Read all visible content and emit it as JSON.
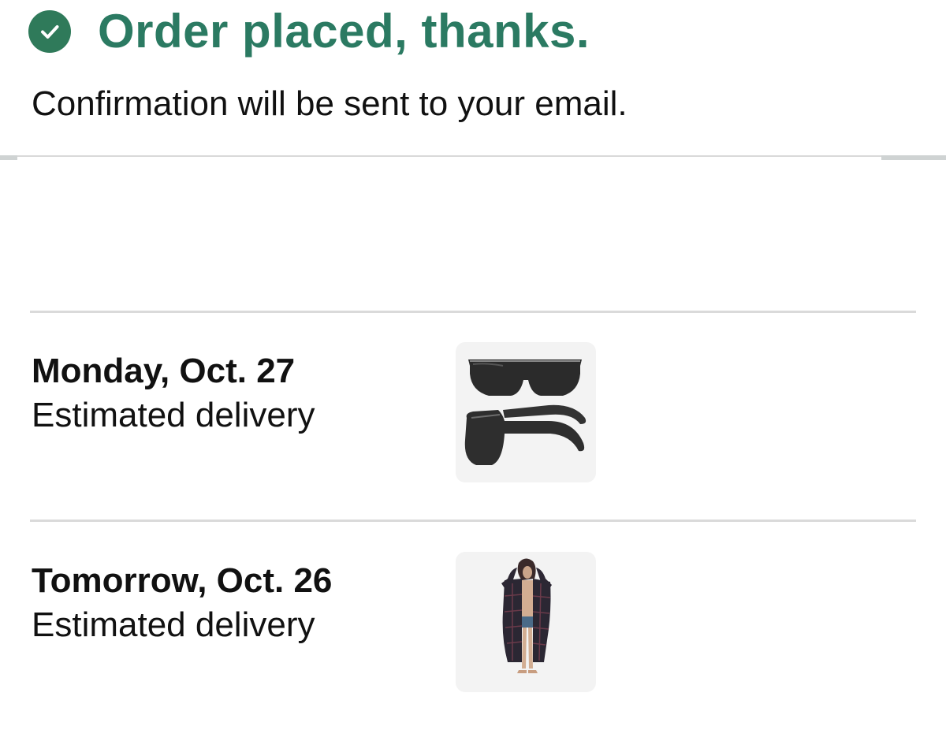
{
  "confirmation": {
    "title": "Order placed, thanks.",
    "subtitle": "Confirmation will be sent to your email.",
    "accent_color": "#2b7a62",
    "icon": "check-circle-icon"
  },
  "shipments": [
    {
      "date": "Monday, Oct. 27",
      "label": "Estimated delivery",
      "product_image": "glasses-product-image"
    },
    {
      "date": "Tomorrow, Oct. 26",
      "label": "Estimated delivery",
      "product_image": "robe-product-image"
    }
  ]
}
